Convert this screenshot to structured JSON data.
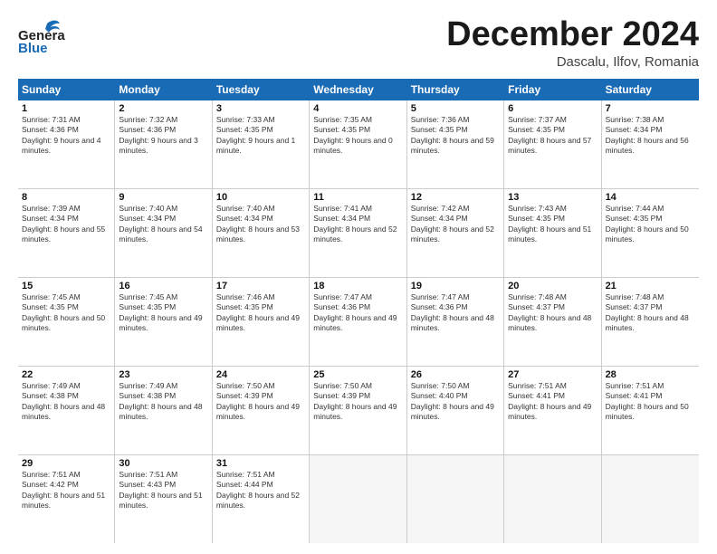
{
  "header": {
    "logo_general": "General",
    "logo_blue": "Blue",
    "month_title": "December 2024",
    "subtitle": "Dascalu, Ilfov, Romania"
  },
  "calendar": {
    "days_of_week": [
      "Sunday",
      "Monday",
      "Tuesday",
      "Wednesday",
      "Thursday",
      "Friday",
      "Saturday"
    ],
    "weeks": [
      [
        {
          "day": 1,
          "sunrise": "7:31 AM",
          "sunset": "4:36 PM",
          "daylight": "9 hours and 4 minutes."
        },
        {
          "day": 2,
          "sunrise": "7:32 AM",
          "sunset": "4:36 PM",
          "daylight": "9 hours and 3 minutes."
        },
        {
          "day": 3,
          "sunrise": "7:33 AM",
          "sunset": "4:35 PM",
          "daylight": "9 hours and 1 minute."
        },
        {
          "day": 4,
          "sunrise": "7:35 AM",
          "sunset": "4:35 PM",
          "daylight": "9 hours and 0 minutes."
        },
        {
          "day": 5,
          "sunrise": "7:36 AM",
          "sunset": "4:35 PM",
          "daylight": "8 hours and 59 minutes."
        },
        {
          "day": 6,
          "sunrise": "7:37 AM",
          "sunset": "4:35 PM",
          "daylight": "8 hours and 57 minutes."
        },
        {
          "day": 7,
          "sunrise": "7:38 AM",
          "sunset": "4:34 PM",
          "daylight": "8 hours and 56 minutes."
        }
      ],
      [
        {
          "day": 8,
          "sunrise": "7:39 AM",
          "sunset": "4:34 PM",
          "daylight": "8 hours and 55 minutes."
        },
        {
          "day": 9,
          "sunrise": "7:40 AM",
          "sunset": "4:34 PM",
          "daylight": "8 hours and 54 minutes."
        },
        {
          "day": 10,
          "sunrise": "7:40 AM",
          "sunset": "4:34 PM",
          "daylight": "8 hours and 53 minutes."
        },
        {
          "day": 11,
          "sunrise": "7:41 AM",
          "sunset": "4:34 PM",
          "daylight": "8 hours and 52 minutes."
        },
        {
          "day": 12,
          "sunrise": "7:42 AM",
          "sunset": "4:34 PM",
          "daylight": "8 hours and 52 minutes."
        },
        {
          "day": 13,
          "sunrise": "7:43 AM",
          "sunset": "4:35 PM",
          "daylight": "8 hours and 51 minutes."
        },
        {
          "day": 14,
          "sunrise": "7:44 AM",
          "sunset": "4:35 PM",
          "daylight": "8 hours and 50 minutes."
        }
      ],
      [
        {
          "day": 15,
          "sunrise": "7:45 AM",
          "sunset": "4:35 PM",
          "daylight": "8 hours and 50 minutes."
        },
        {
          "day": 16,
          "sunrise": "7:45 AM",
          "sunset": "4:35 PM",
          "daylight": "8 hours and 49 minutes."
        },
        {
          "day": 17,
          "sunrise": "7:46 AM",
          "sunset": "4:35 PM",
          "daylight": "8 hours and 49 minutes."
        },
        {
          "day": 18,
          "sunrise": "7:47 AM",
          "sunset": "4:36 PM",
          "daylight": "8 hours and 49 minutes."
        },
        {
          "day": 19,
          "sunrise": "7:47 AM",
          "sunset": "4:36 PM",
          "daylight": "8 hours and 48 minutes."
        },
        {
          "day": 20,
          "sunrise": "7:48 AM",
          "sunset": "4:37 PM",
          "daylight": "8 hours and 48 minutes."
        },
        {
          "day": 21,
          "sunrise": "7:48 AM",
          "sunset": "4:37 PM",
          "daylight": "8 hours and 48 minutes."
        }
      ],
      [
        {
          "day": 22,
          "sunrise": "7:49 AM",
          "sunset": "4:38 PM",
          "daylight": "8 hours and 48 minutes."
        },
        {
          "day": 23,
          "sunrise": "7:49 AM",
          "sunset": "4:38 PM",
          "daylight": "8 hours and 48 minutes."
        },
        {
          "day": 24,
          "sunrise": "7:50 AM",
          "sunset": "4:39 PM",
          "daylight": "8 hours and 49 minutes."
        },
        {
          "day": 25,
          "sunrise": "7:50 AM",
          "sunset": "4:39 PM",
          "daylight": "8 hours and 49 minutes."
        },
        {
          "day": 26,
          "sunrise": "7:50 AM",
          "sunset": "4:40 PM",
          "daylight": "8 hours and 49 minutes."
        },
        {
          "day": 27,
          "sunrise": "7:51 AM",
          "sunset": "4:41 PM",
          "daylight": "8 hours and 49 minutes."
        },
        {
          "day": 28,
          "sunrise": "7:51 AM",
          "sunset": "4:41 PM",
          "daylight": "8 hours and 50 minutes."
        }
      ],
      [
        {
          "day": 29,
          "sunrise": "7:51 AM",
          "sunset": "4:42 PM",
          "daylight": "8 hours and 51 minutes."
        },
        {
          "day": 30,
          "sunrise": "7:51 AM",
          "sunset": "4:43 PM",
          "daylight": "8 hours and 51 minutes."
        },
        {
          "day": 31,
          "sunrise": "7:51 AM",
          "sunset": "4:44 PM",
          "daylight": "8 hours and 52 minutes."
        },
        null,
        null,
        null,
        null
      ]
    ]
  }
}
